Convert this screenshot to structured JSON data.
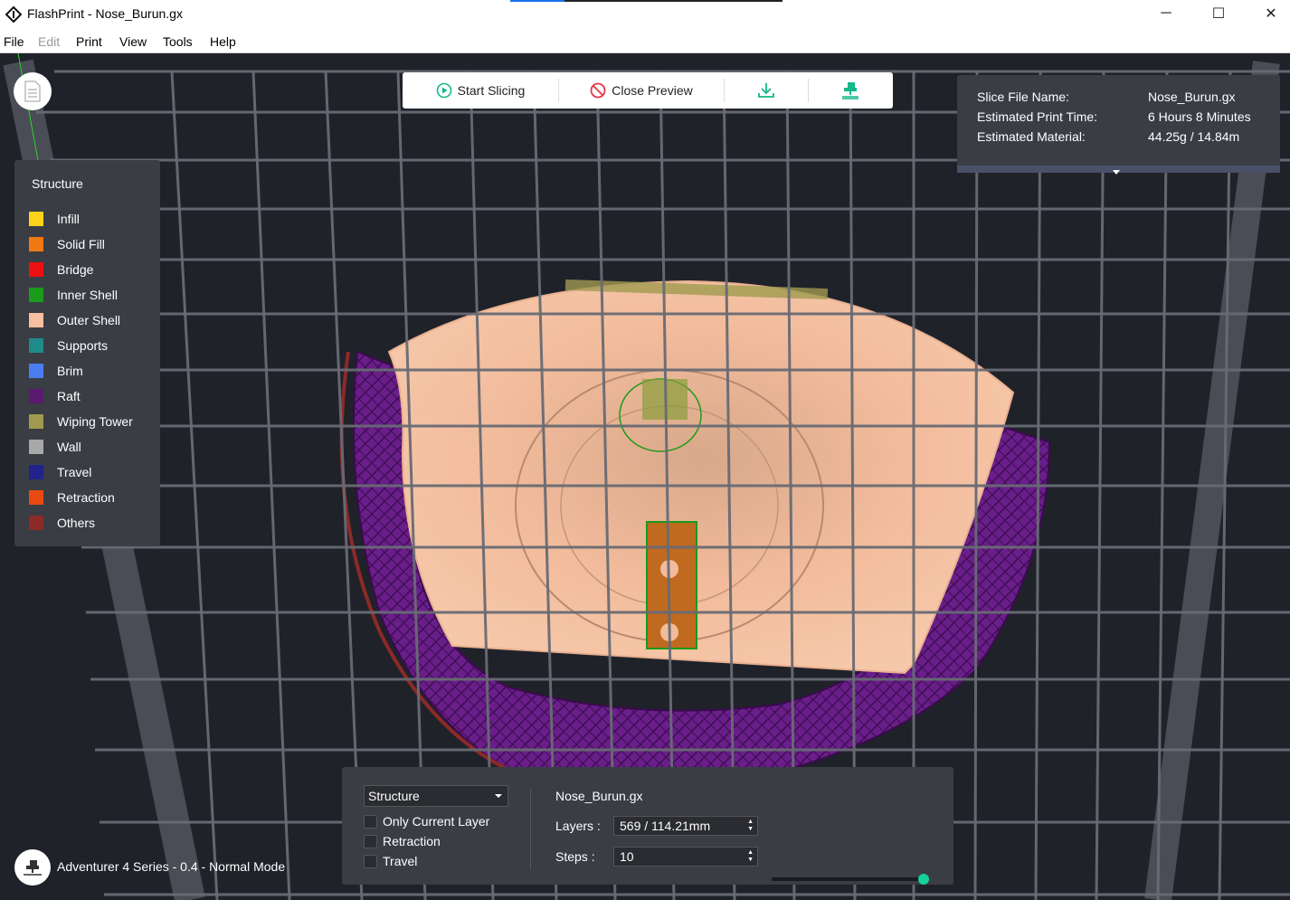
{
  "window": {
    "title": "FlashPrint - Nose_Burun.gx",
    "minimize_label": "─",
    "maximize_label": "☐",
    "close_label": "✕"
  },
  "menu": {
    "items": [
      "File",
      "Edit",
      "Print",
      "View",
      "Tools",
      "Help"
    ]
  },
  "toolbar": {
    "start_slicing": "Start Slicing",
    "close_preview": "Close Preview"
  },
  "legend": {
    "header": "Structure",
    "items": [
      {
        "label": "Infill",
        "color": "#ffd21a"
      },
      {
        "label": "Solid Fill",
        "color": "#f07a12"
      },
      {
        "label": "Bridge",
        "color": "#ee1010"
      },
      {
        "label": "Inner Shell",
        "color": "#1a9c1a"
      },
      {
        "label": "Outer Shell",
        "color": "#f8c0a0"
      },
      {
        "label": "Supports",
        "color": "#1f8a8a"
      },
      {
        "label": "Brim",
        "color": "#4a7ef0"
      },
      {
        "label": "Raft",
        "color": "#5a1a6e"
      },
      {
        "label": "Wiping Tower",
        "color": "#a09a50"
      },
      {
        "label": "Wall",
        "color": "#a8a8a8"
      },
      {
        "label": "Travel",
        "color": "#22228c"
      },
      {
        "label": "Retraction",
        "color": "#e84a12"
      },
      {
        "label": "Others",
        "color": "#8c2a28"
      }
    ]
  },
  "info": {
    "slice_file_label": "Slice File Name:",
    "slice_file_value": "Nose_Burun.gx",
    "print_time_label": "Estimated Print Time:",
    "print_time_value": "6 Hours 8 Minutes",
    "material_label": "Estimated Material:",
    "material_value": "44.25g / 14.84m"
  },
  "controls": {
    "view_mode": "Structure",
    "only_current_layer": "Only Current Layer",
    "retraction": "Retraction",
    "travel": "Travel",
    "file_name": "Nose_Burun.gx",
    "layers_label": "Layers :",
    "layers_value": "569 / 114.21mm",
    "steps_label": "Steps :",
    "steps_value": "10",
    "layers_slider_level": 1.0,
    "steps_slider_level": 1.0
  },
  "machine": {
    "label": "Adventurer 4 Series - 0.4 - Normal Mode"
  },
  "colors": {
    "accent": "#14d39a",
    "panel": "#3a3d44",
    "raft": "#6a1e8a",
    "outer_shell": "#f2b898"
  }
}
